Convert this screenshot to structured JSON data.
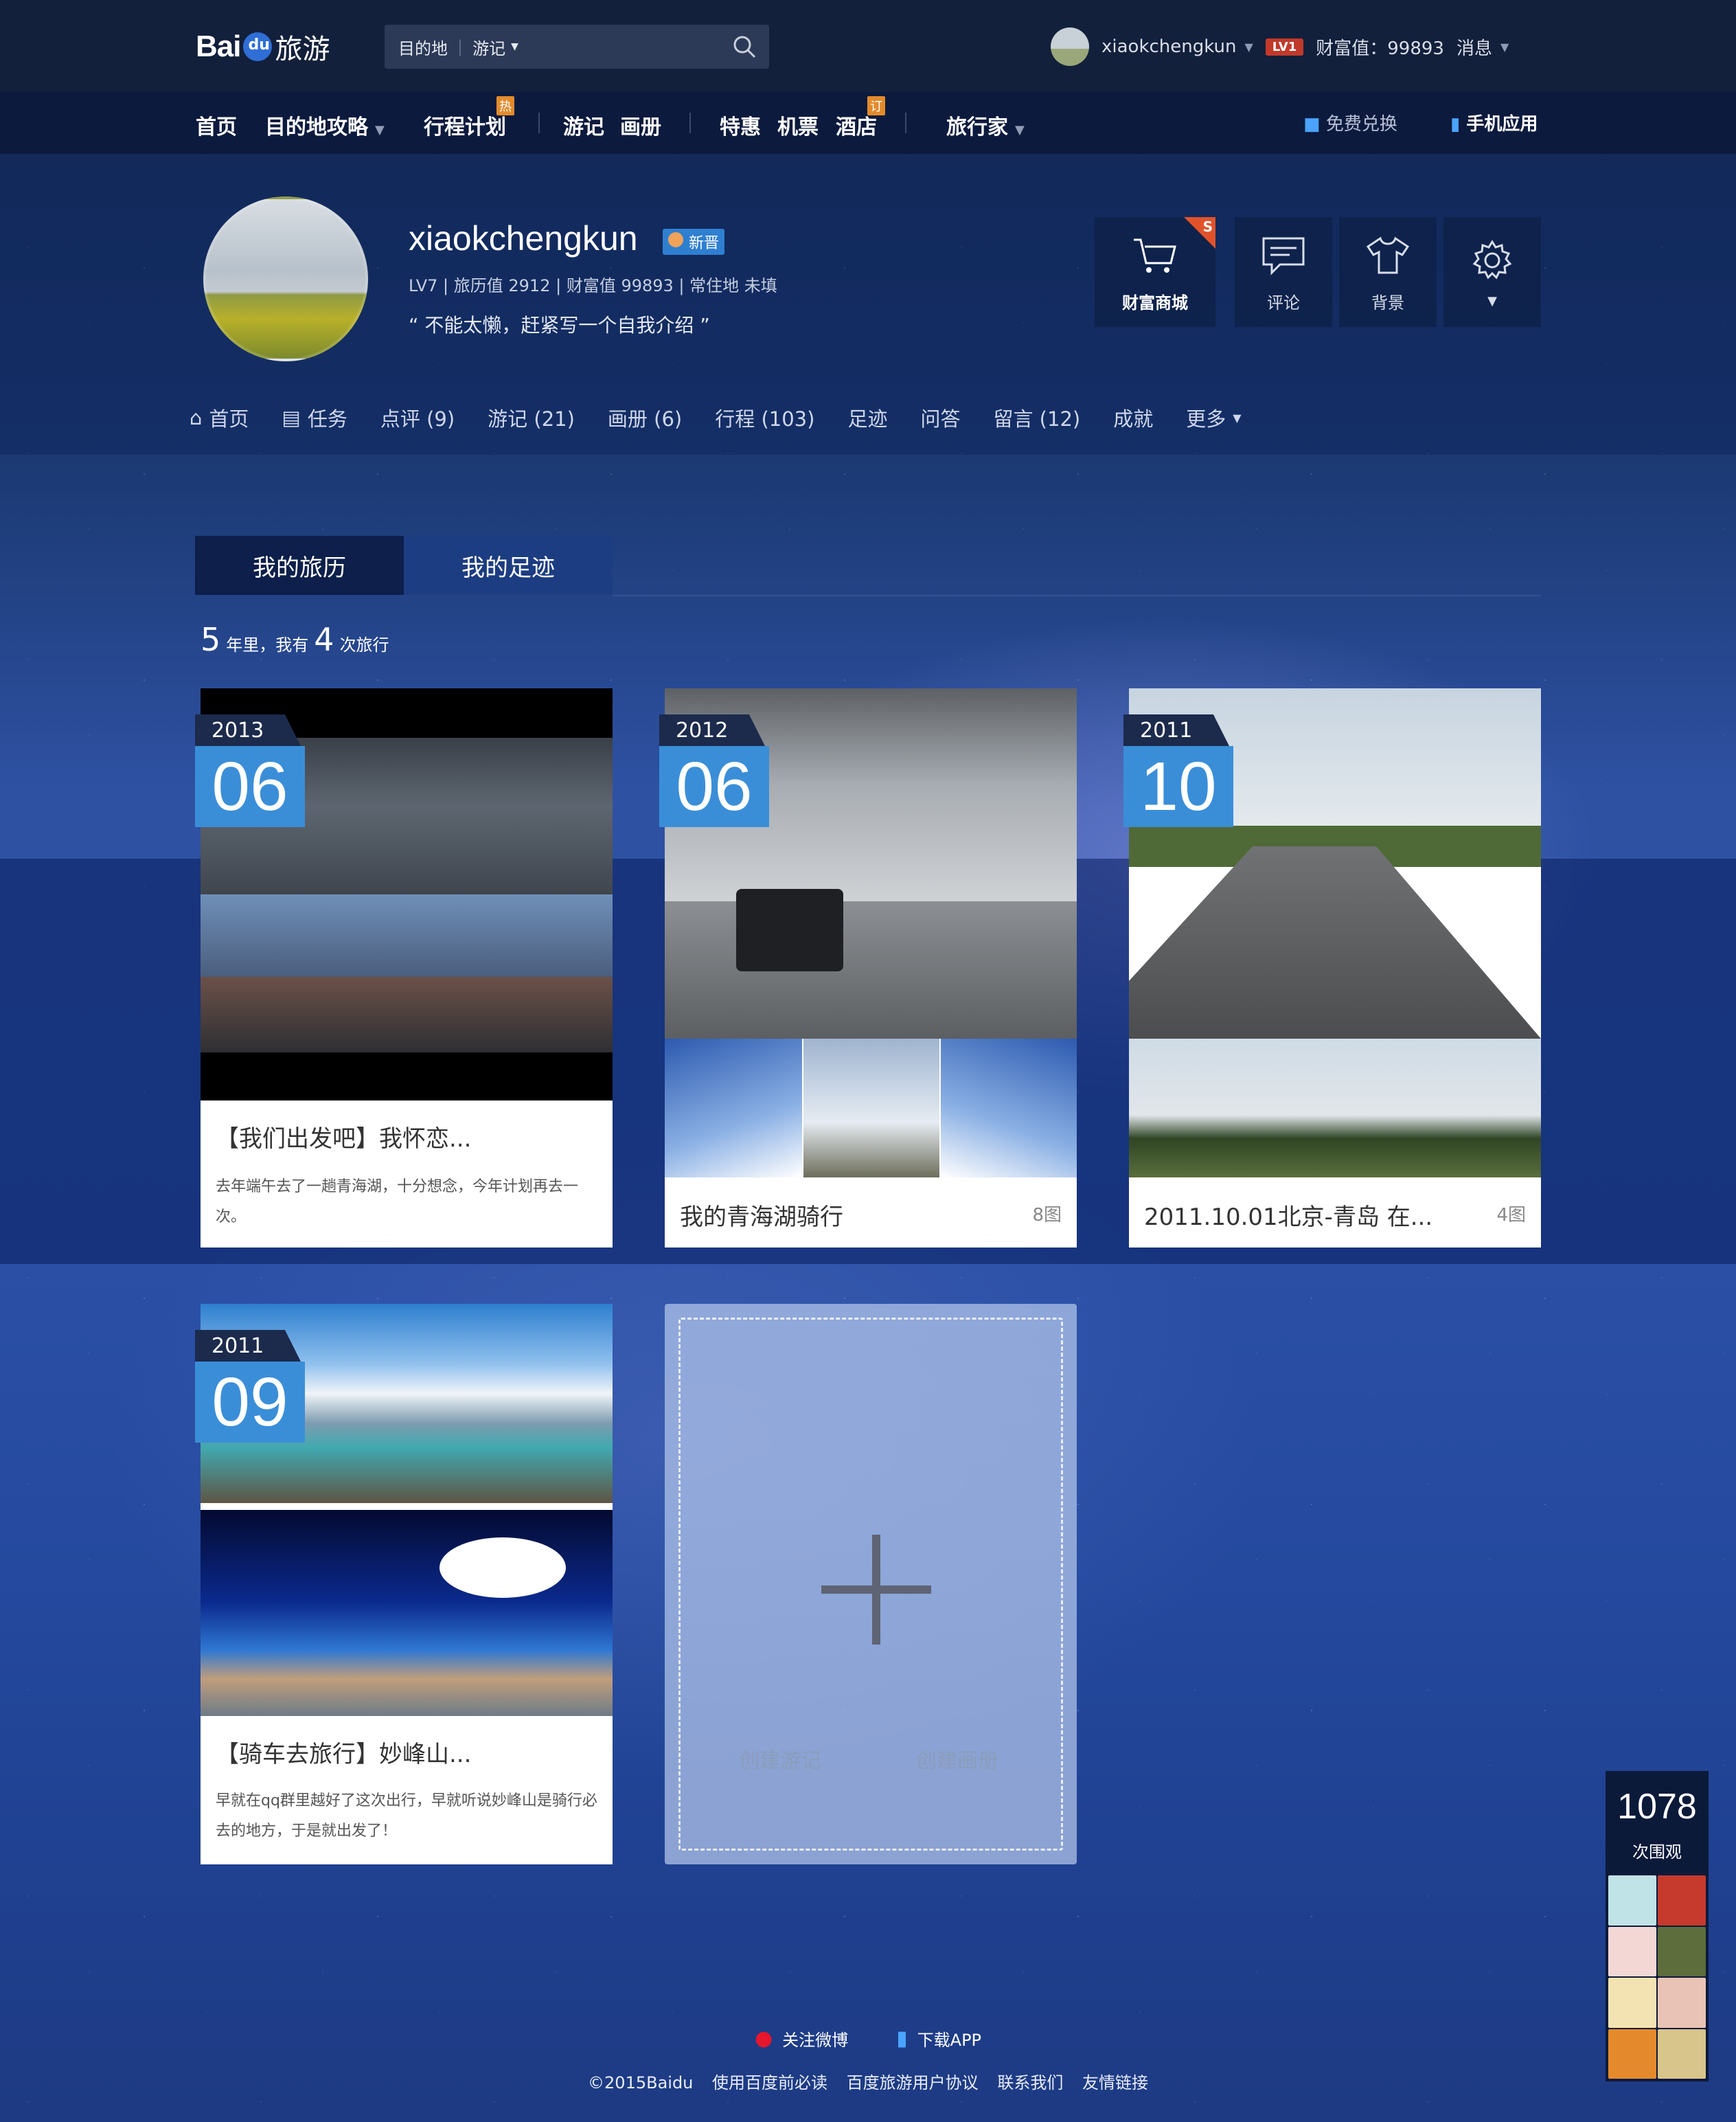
{
  "header": {
    "logo_text": "Bai",
    "logo_paw": "du",
    "logo_suffix": "旅游",
    "search": {
      "scope1": "目的地",
      "scope2": "游记"
    },
    "user": {
      "name": "xiaokchengkun",
      "level": "LV1",
      "wealth": "财富值：99893",
      "messages": "消息"
    }
  },
  "nav": {
    "items": [
      "首页",
      "目的地攻略",
      "行程计划",
      "游记",
      "画册",
      "特惠",
      "机票",
      "酒店",
      "旅行家"
    ],
    "hot_badge": "热",
    "order_badge": "订",
    "right": [
      "免费兑换",
      "手机应用"
    ]
  },
  "profile": {
    "name": "xiaokchengkun",
    "badge": "新晋",
    "meta": "LV7 | 旅历值 2912 | 财富值 99893 | 常住地 未填",
    "intro": "“ 不能太懒，赶紧写一个自我介绍 ”",
    "actions": [
      {
        "label": "财富商城",
        "badge": "S"
      },
      {
        "label": "评论"
      },
      {
        "label": "背景"
      }
    ]
  },
  "profile_tabs": [
    "首页",
    "任务",
    "点评 (9)",
    "游记 (21)",
    "画册 (6)",
    "行程 (103)",
    "足迹",
    "问答",
    "留言 (12)",
    "成就",
    "更多"
  ],
  "section_tabs": [
    "我的旅历",
    "我的足迹"
  ],
  "summary": {
    "years": "5",
    "text1": "年里，我有",
    "trips": "4",
    "text2": "次旅行"
  },
  "cards": [
    {
      "year": "2013",
      "month": "06",
      "title": "【我们出发吧】我怀恋...",
      "desc": "去年端午去了一趟青海湖，十分想念，今年计划再去一次。"
    },
    {
      "year": "2012",
      "month": "06",
      "title": "我的青海湖骑行",
      "count": "8图"
    },
    {
      "year": "2011",
      "month": "10",
      "title": "2011.10.01北京-青岛 在...",
      "count": "4图"
    },
    {
      "year": "2011",
      "month": "09",
      "title": "【骑车去旅行】妙峰山...",
      "desc": "早就在qq群里越好了这次出行，早就听说妙峰山是骑行必去的地方，于是就出发了！"
    }
  ],
  "new_card": {
    "create_note": "创建游记",
    "create_album": "创建画册"
  },
  "visits": {
    "count": "1078",
    "label": "次围观"
  },
  "footer": {
    "weibo": "关注微博",
    "app": "下载APP",
    "links": [
      "©2015Baidu",
      "使用百度前必读",
      "百度旅游用户协议",
      "联系我们",
      "友情链接"
    ]
  },
  "colors": {
    "accent": "#3a8ed8",
    "header_bg": "#13203b",
    "nav_bg": "#0c1a3d",
    "hot": "#e38b2c"
  }
}
